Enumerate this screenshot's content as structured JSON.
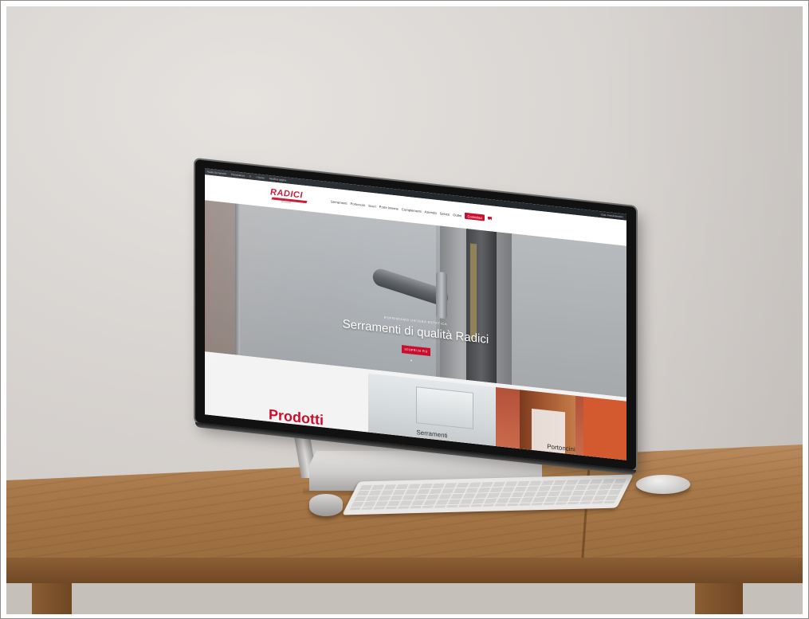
{
  "site": {
    "admin_bar": {
      "items": [
        "Radici Serramenti",
        "Personalizza",
        "0",
        "+ Nuovo",
        "Modifica pagina"
      ],
      "right": "Ciao, Amministratore"
    },
    "logo": {
      "text": "RADICI",
      "tagline": "serramenti"
    },
    "nav": {
      "items": [
        "Serramenti",
        "Portoncini",
        "Scuri",
        "Porte Interne",
        "Complementi",
        "Azienda",
        "Servizi",
        "Outlet"
      ],
      "contact_label": "Contattaci"
    },
    "hero": {
      "kicker": "ESPRIMIAMO UN'IDEA ESTETICA",
      "title": "Serramenti di qualità Radici",
      "button_label": "SCOPRI DI PIÙ"
    },
    "products": {
      "title": "Prodotti",
      "cards": [
        {
          "label": "Serramenti"
        },
        {
          "label": "Portoncini"
        }
      ]
    }
  },
  "colors": {
    "brand_red": "#c8102e",
    "admin_bar": "#23282d"
  }
}
